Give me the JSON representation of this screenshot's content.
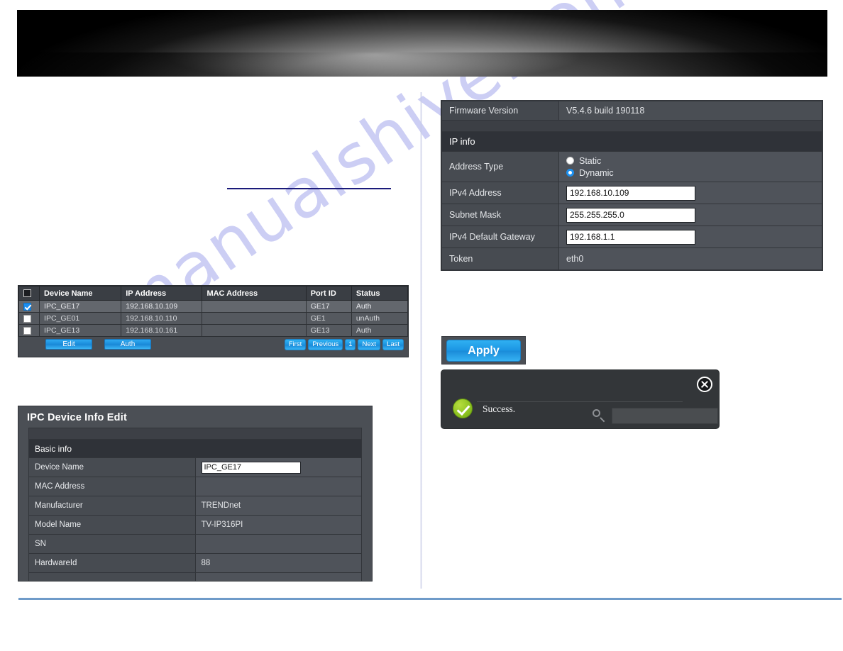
{
  "watermark": {
    "text": "manualshive.com"
  },
  "colors": {
    "accent_blue": "#1b8ddc",
    "panel_dark": "#4b4f55",
    "section_dark": "#2f3238",
    "success_green": "#8cc220",
    "navy_rule": "#1b1b7a",
    "footer_rule": "#6f9bc9"
  },
  "device_table": {
    "columns": [
      "",
      "Device Name",
      "IP Address",
      "MAC Address",
      "Port ID",
      "Status"
    ],
    "rows": [
      {
        "selected": true,
        "device_name": "IPC_GE17",
        "ip_address": "192.168.10.109",
        "mac_address": "",
        "port_id": "GE17",
        "status": "Auth"
      },
      {
        "selected": false,
        "device_name": "IPC_GE01",
        "ip_address": "192.168.10.110",
        "mac_address": "",
        "port_id": "GE1",
        "status": "unAuth"
      },
      {
        "selected": false,
        "device_name": "IPC_GE13",
        "ip_address": "192.168.10.161",
        "mac_address": "",
        "port_id": "GE13",
        "status": "Auth"
      }
    ],
    "buttons": {
      "edit": "Edit",
      "auth": "Auth"
    },
    "pager": {
      "first": "First",
      "previous": "Previous",
      "current": "1",
      "next": "Next",
      "last": "Last"
    }
  },
  "edit_panel": {
    "title": "IPC Device Info Edit",
    "section": "Basic info",
    "fields": [
      {
        "label": "Device Name",
        "value": "IPC_GE17",
        "input": true
      },
      {
        "label": "MAC Address",
        "value": "",
        "input": false
      },
      {
        "label": "Manufacturer",
        "value": "TRENDnet",
        "input": false
      },
      {
        "label": "Model Name",
        "value": "TV-IP316PI",
        "input": false
      },
      {
        "label": "SN",
        "value": "",
        "input": false
      },
      {
        "label": "HardwareId",
        "value": "88",
        "input": false
      }
    ]
  },
  "ip_panel": {
    "firmware_label": "Firmware Version",
    "firmware_value": "V5.4.6 build 190118",
    "section": "IP info",
    "address_type_label": "Address Type",
    "address_type_options": [
      {
        "label": "Static",
        "selected": false
      },
      {
        "label": "Dynamic",
        "selected": true
      }
    ],
    "fields": [
      {
        "label": "IPv4 Address",
        "value": "192.168.10.109",
        "input": true
      },
      {
        "label": "Subnet Mask",
        "value": "255.255.255.0",
        "input": true
      },
      {
        "label": "IPv4 Default Gateway",
        "value": "192.168.1.1",
        "input": true
      }
    ],
    "token_label": "Token",
    "token_value": "eth0"
  },
  "apply": {
    "label": "Apply"
  },
  "success_dialog": {
    "message": "Success.",
    "close_label": "×",
    "search_value": "",
    "search_placeholder": ""
  }
}
